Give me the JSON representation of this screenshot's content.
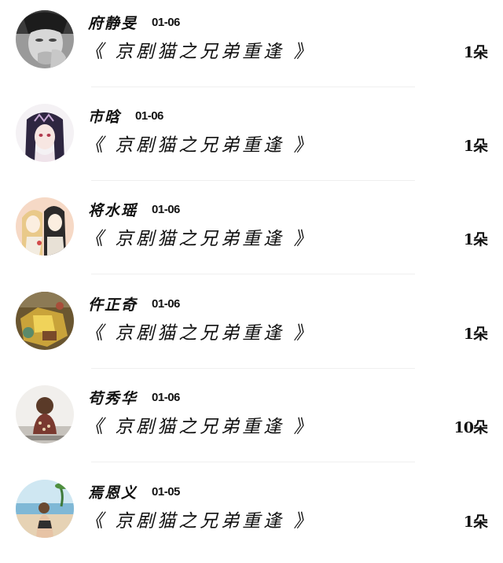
{
  "items": [
    {
      "name": "府静旻",
      "date": "01-06",
      "title": "《 京剧猫之兄弟重逢 》",
      "count": "1朵",
      "avatar_icon": "avatar-crying-woman"
    },
    {
      "name": "市晗",
      "date": "01-06",
      "title": "《 京剧猫之兄弟重逢 》",
      "count": "1朵",
      "avatar_icon": "avatar-anime-girl"
    },
    {
      "name": "将水瑶",
      "date": "01-06",
      "title": "《 京剧猫之兄弟重逢 》",
      "count": "1朵",
      "avatar_icon": "avatar-illustrated-couple"
    },
    {
      "name": "仵正奇",
      "date": "01-06",
      "title": "《 京剧猫之兄弟重逢 》",
      "count": "1朵",
      "avatar_icon": "avatar-golden-still-life"
    },
    {
      "name": "苟秀华",
      "date": "01-06",
      "title": "《 京剧猫之兄弟重逢 》",
      "count": "10朵",
      "avatar_icon": "avatar-girl-back-view"
    },
    {
      "name": "焉恩义",
      "date": "01-05",
      "title": "《 京剧猫之兄弟重逢 》",
      "count": "1朵",
      "avatar_icon": "avatar-beach-woman"
    }
  ],
  "colors": {
    "background": "#ffffff",
    "text": "#111111",
    "divider": "#efefef"
  }
}
